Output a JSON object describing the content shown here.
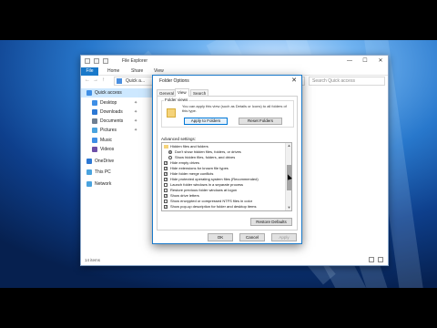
{
  "explorer": {
    "title": "File Explorer",
    "window_controls": [
      "—",
      "☐",
      "✕"
    ],
    "ribbon_tabs": [
      "File",
      "Home",
      "Share",
      "View"
    ],
    "address_path": "Quick a...",
    "search_placeholder": "Search Quick access",
    "nav_items": [
      {
        "label": "Quick access",
        "icon": "star-icon",
        "color": "#3f8fe6",
        "pinned": false,
        "selected": true
      },
      {
        "label": "Desktop",
        "icon": "desktop-icon",
        "color": "#3f8fe6",
        "pinned": true
      },
      {
        "label": "Downloads",
        "icon": "download-icon",
        "color": "#2c78d4",
        "pinned": true
      },
      {
        "label": "Documents",
        "icon": "documents-icon",
        "color": "#6f7f92",
        "pinned": true
      },
      {
        "label": "Pictures",
        "icon": "pictures-icon",
        "color": "#4aa3df",
        "pinned": true
      },
      {
        "label": "Music",
        "icon": "music-icon",
        "color": "#3f8fe6",
        "pinned": false
      },
      {
        "label": "Videos",
        "icon": "videos-icon",
        "color": "#6d4fa8",
        "pinned": false
      },
      {
        "label": "OneDrive",
        "icon": "cloud-icon",
        "color": "#2c78d4",
        "pinned": false
      },
      {
        "label": "This PC",
        "icon": "computer-icon",
        "color": "#4aa3df",
        "pinned": false
      },
      {
        "label": "Network",
        "icon": "network-icon",
        "color": "#4aa3df",
        "pinned": false
      }
    ],
    "status": "14 items"
  },
  "dialog": {
    "title": "Folder Options",
    "close_glyph": "✕",
    "tabs": [
      {
        "label": "General"
      },
      {
        "label": "View",
        "active": true
      },
      {
        "label": "Search"
      }
    ],
    "folder_views": {
      "label": "Folder views",
      "description": "You can apply this view (such as Details or Icons) to all folders of this type.",
      "apply_button": "Apply to Folders",
      "reset_button": "Reset Folders"
    },
    "advanced_label": "Advanced settings:",
    "settings": [
      {
        "type": "folder",
        "label": "Hidden files and folders"
      },
      {
        "type": "radio",
        "checked": true,
        "label": "Don't show hidden files, folders, or drives"
      },
      {
        "type": "radio",
        "checked": false,
        "label": "Show hidden files, folders, and drives"
      },
      {
        "type": "checkbox",
        "checked": true,
        "label": "Hide empty drives"
      },
      {
        "type": "checkbox",
        "checked": true,
        "label": "Hide extensions for known file types"
      },
      {
        "type": "checkbox",
        "checked": true,
        "label": "Hide folder merge conflicts"
      },
      {
        "type": "checkbox",
        "checked": true,
        "label": "Hide protected operating system files (Recommended)"
      },
      {
        "type": "checkbox",
        "checked": false,
        "label": "Launch folder windows in a separate process"
      },
      {
        "type": "checkbox",
        "checked": false,
        "label": "Restore previous folder windows at logon"
      },
      {
        "type": "checkbox",
        "checked": true,
        "label": "Show drive letters"
      },
      {
        "type": "checkbox",
        "checked": false,
        "label": "Show encrypted or compressed NTFS files in color"
      },
      {
        "type": "checkbox",
        "checked": true,
        "label": "Show pop-up description for folder and desktop items"
      }
    ],
    "restore_button": "Restore Defaults",
    "ok_button": "OK",
    "cancel_button": "Cancel",
    "apply_button": "Apply"
  }
}
